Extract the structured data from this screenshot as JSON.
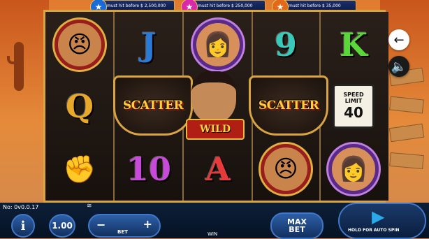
{
  "jackpots": [
    {
      "icon": "blue-star-icon",
      "color": "#1a6ad8",
      "text": "must hit before $ 2,500,000"
    },
    {
      "icon": "pink-star-icon",
      "color": "#d82aa8",
      "text": "must hit before $ 250,000"
    },
    {
      "icon": "orange-star-icon",
      "color": "#e06a1a",
      "text": "must hit before $ 35,000"
    }
  ],
  "reels": {
    "scatter_label": "SCATTER",
    "wild_label": "WILD",
    "letters": {
      "j": "J",
      "q_top": "9",
      "k": "K",
      "q": "Q",
      "ten": "10",
      "a": "A"
    },
    "speed_sign": {
      "line1": "SPEED",
      "line2": "LIMIT",
      "number": "40"
    }
  },
  "footer": {
    "build": "No: 0v0.0.17",
    "info_label": "i",
    "coin_value": "1.00",
    "bet_label": "BET",
    "minus_label": "−",
    "plus_label": "+",
    "win_label": "WIN",
    "max_bet_line1": "MAX",
    "max_bet_line2": "BET",
    "auto_spin_hint": "HOLD FOR AUTO SPIN",
    "spin_icon": "play-icon"
  },
  "side": {
    "back_icon": "arrow-left-icon",
    "sound_icon": "speaker-mute-icon"
  }
}
